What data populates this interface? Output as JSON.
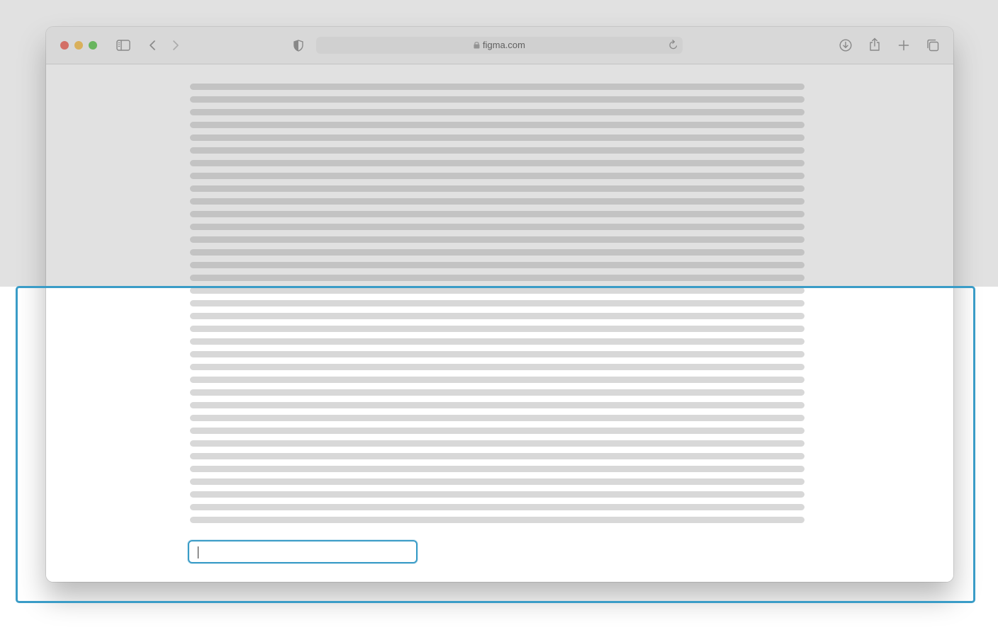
{
  "browser": {
    "address": "figma.com",
    "icons": {
      "sidebar": "sidebar-toggle-icon",
      "back": "chevron-left-icon",
      "forward": "chevron-right-icon",
      "privacy": "shield-icon",
      "lock": "lock-icon",
      "reload": "reload-icon",
      "downloads": "download-icon",
      "share": "share-icon",
      "new_tab": "plus-icon",
      "tabs": "tab-overview-icon"
    }
  },
  "page": {
    "placeholder_line_count": 35,
    "input_value": ""
  },
  "colors": {
    "focus": "#3a9cc7",
    "placeholder_line": "#d8d8d8"
  }
}
